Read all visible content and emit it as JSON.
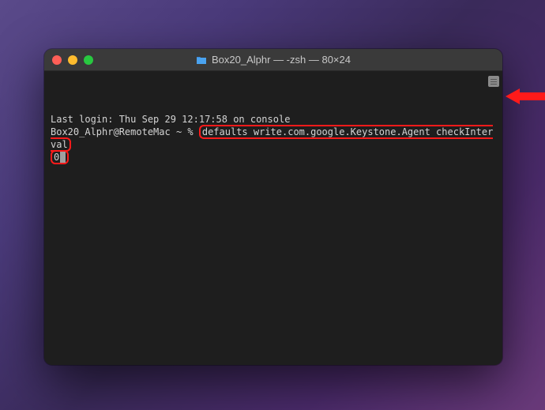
{
  "window": {
    "title": "Box20_Alphr — -zsh — 80×24"
  },
  "terminal": {
    "last_login": "Last login: Thu Sep 29 12:17:58 on console",
    "prompt": "Box20_Alphr@RemoteMac ~ % ",
    "command_part1": "defaults write.com.google.Keystone.Agent checkInterval",
    "command_part2": "0"
  }
}
